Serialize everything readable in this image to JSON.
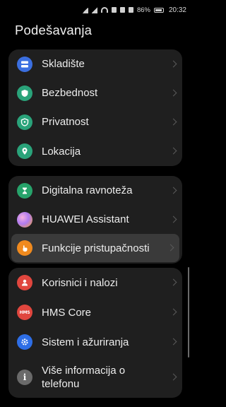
{
  "status_bar": {
    "battery": "86%",
    "time": "20:32"
  },
  "page": {
    "title": "Podešavanja"
  },
  "groups": [
    {
      "items": [
        {
          "label": "Skladište",
          "icon": "storage-icon",
          "color": "#3b6fe0"
        },
        {
          "label": "Bezbednost",
          "icon": "shield-icon",
          "color": "#2aa37a"
        },
        {
          "label": "Privatnost",
          "icon": "privacy-icon",
          "color": "#2aa37a"
        },
        {
          "label": "Lokacija",
          "icon": "location-pin-icon",
          "color": "#2aa37a"
        }
      ]
    },
    {
      "items": [
        {
          "label": "Digitalna ravnoteža",
          "icon": "hourglass-icon",
          "color": "#27a36b"
        },
        {
          "label": "HUAWEI Assistant",
          "icon": "assistant-icon",
          "color": "#8e6cf0"
        },
        {
          "label": "Funkcije pristupačnosti",
          "icon": "accessibility-hand-icon",
          "color": "#f08a1e"
        }
      ]
    },
    {
      "items": [
        {
          "label": "Korisnici i nalozi",
          "icon": "user-icon",
          "color": "#e0463e"
        },
        {
          "label": "HMS Core",
          "icon": "hms-icon",
          "color": "#e0463e",
          "badge": "HMS"
        },
        {
          "label": "Sistem i ažuriranja",
          "icon": "system-gear-icon",
          "color": "#2e6ee6"
        },
        {
          "label": "Više informacija o telefonu",
          "icon": "info-icon",
          "color": "#6a6a6a"
        }
      ]
    }
  ]
}
